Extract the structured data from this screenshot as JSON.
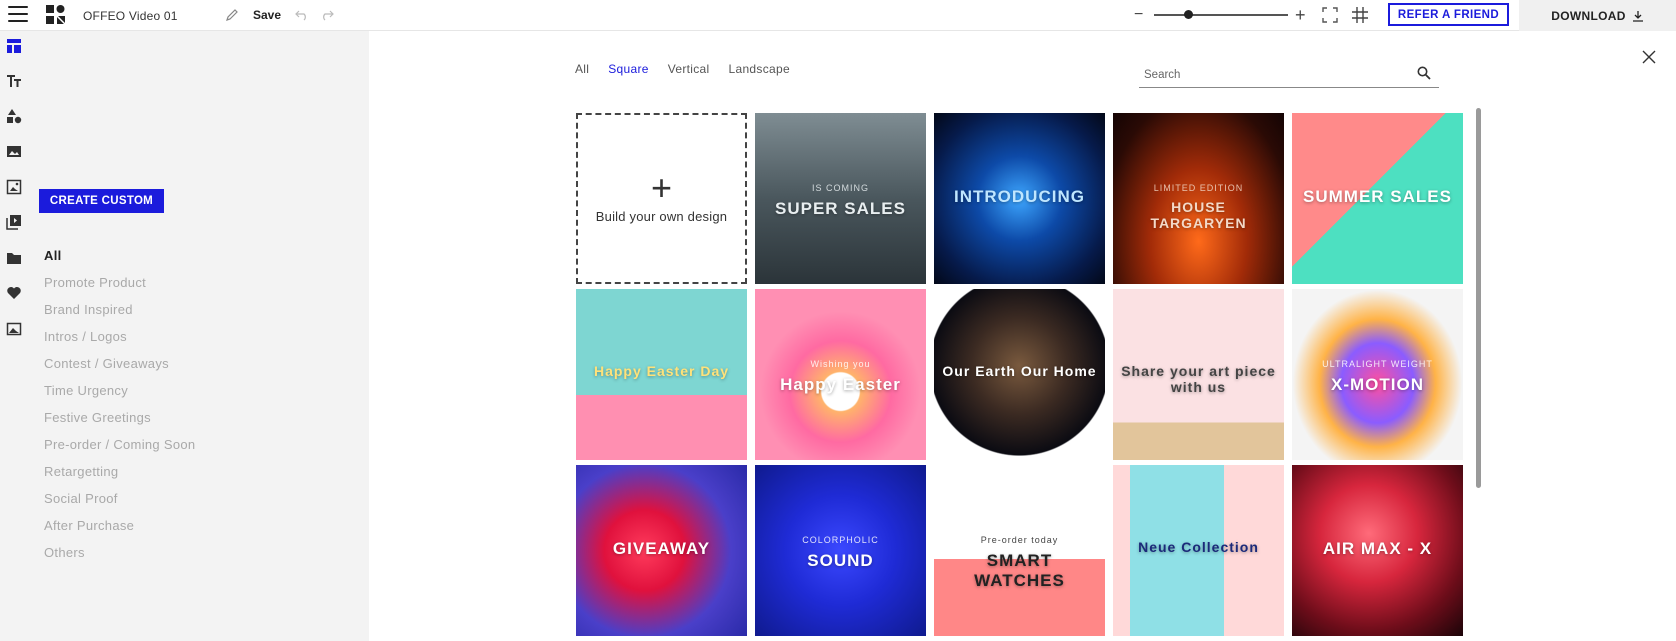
{
  "app": {
    "project_title": "OFFEO Video 01",
    "save_label": "Save",
    "refer_label": "REFER A FRIEND",
    "download_label": "DOWNLOAD",
    "zoom_level": 0.25,
    "accent_color": "#1b1bdc"
  },
  "rail": {
    "icons": [
      "templates-icon",
      "text-icon",
      "shapes-icon",
      "images-icon",
      "photo-icon",
      "media-library-icon",
      "folder-icon",
      "heart-icon",
      "background-icon"
    ]
  },
  "panel": {
    "create_label": "CREATE CUSTOM",
    "categories": [
      {
        "label": "All",
        "active": true
      },
      {
        "label": "Promote Product"
      },
      {
        "label": "Brand Inspired"
      },
      {
        "label": "Intros / Logos"
      },
      {
        "label": "Contest / Giveaways"
      },
      {
        "label": "Time Urgency"
      },
      {
        "label": "Festive Greetings"
      },
      {
        "label": "Pre-order / Coming Soon"
      },
      {
        "label": "Retargetting"
      },
      {
        "label": "Social Proof"
      },
      {
        "label": "After Purchase"
      },
      {
        "label": "Others"
      }
    ]
  },
  "main": {
    "tabs": [
      {
        "label": "All"
      },
      {
        "label": "Square",
        "active": true
      },
      {
        "label": "Vertical"
      },
      {
        "label": "Landscape"
      }
    ],
    "search_placeholder": "Search",
    "build_label": "Build your own design",
    "templates": [
      {
        "title": "SUPER SALES",
        "sub": "IS COMING",
        "bg": "linear-gradient(180deg,#7f8d93 0%,#4a575d 50%,#2b3439 100%)",
        "color": "#e8eef0"
      },
      {
        "title": "INTRODUCING",
        "bg": "radial-gradient(ellipse at 50% 50%,#3da6ff 0%,#0d4aa8 35%,#061a4a 75%,#020818 100%)",
        "color": "#bfe6ff"
      },
      {
        "title": "HOUSE TARGARYEN",
        "sub": "LIMITED EDITION",
        "bg": "radial-gradient(ellipse at 50% 75%,#ff6a1a 0%,#a22b08 40%,#2a0a05 80%,#140404 100%)",
        "color": "#f3d9c8"
      },
      {
        "title": "SUMMER SALES",
        "bg": "linear-gradient(135deg,#ff8a8a 0%,#ff8a8a 45%,#4de0c1 45%,#4de0c1 100%)",
        "color": "#ffffff"
      },
      {
        "title": "Happy Easter Day",
        "bg": "linear-gradient(180deg,#7ed6d2 0%,#7ed6d2 62%,#ff8fb1 62%,#ff8fb1 100%)",
        "color": "#ffe27a"
      },
      {
        "title": "Happy Easter",
        "sub": "Wishing you",
        "bg": "radial-gradient(circle at 50% 60%,#ffffff 0%,#ffffff 14%,#ffb36b 15%,#ff6aa2 38%,#ff8fb3 60%,#ff8fb3 100%)",
        "color": "#ffffff"
      },
      {
        "title": "Our Earth Our Home",
        "bg": "radial-gradient(circle at 50% 45%,#7a5a3e 0%,#3b2a22 38%,#0b0b12 70%,#ffffff 71%,#ffffff 100%)",
        "color": "#ffffff"
      },
      {
        "title": "Share your art piece with us",
        "bg": "linear-gradient(180deg,#fbe1e3 0%,#fbe1e3 78%,#e2c59b 78%,#e2c59b 100%)",
        "color": "#444444"
      },
      {
        "title": "X-MOTION",
        "sub": "ULTRALIGHT WEIGHT",
        "bg": "radial-gradient(ellipse at 50% 55%,#ff4fa0 0%,#8b5cff 30%,#ffb347 48%,#f4f4f4 70%,#f4f4f4 100%)",
        "color": "#ffffff"
      },
      {
        "title": "GIVEAWAY",
        "bg": "radial-gradient(circle at 40% 50%,#ff3b5c 0%,#e0113d 30%,#4a3fc9 65%,#2a2aa8 100%)",
        "color": "#ffffff"
      },
      {
        "title": "SOUND",
        "sub": "COLORPHOLIC",
        "bg": "radial-gradient(circle at 50% 50%,#3b48ff 0%,#1f2bd6 45%,#0f1a8e 100%)",
        "color": "#ffffff"
      },
      {
        "title": "SMART WATCHES",
        "sub": "Pre-order today",
        "bg": "linear-gradient(180deg,#ffffff 0%,#ffffff 55%,#ff8787 55%,#ff8787 100%)",
        "color": "#222222"
      },
      {
        "title": "Neue Collection",
        "bg": "linear-gradient(90deg,#ffd9d9 0%,#ffd9d9 10%,#8fe0e6 10%,#8fe0e6 65%,#ffd9d9 65%,#ffd9d9 100%)",
        "color": "#1b2a7a"
      },
      {
        "title": "AIR MAX - X",
        "bg": "radial-gradient(circle at 45% 40%,#ff6b7a 0%,#d7263d 35%,#6e0d1a 70%,#1a0408 100%)",
        "color": "#ffffff"
      }
    ]
  }
}
